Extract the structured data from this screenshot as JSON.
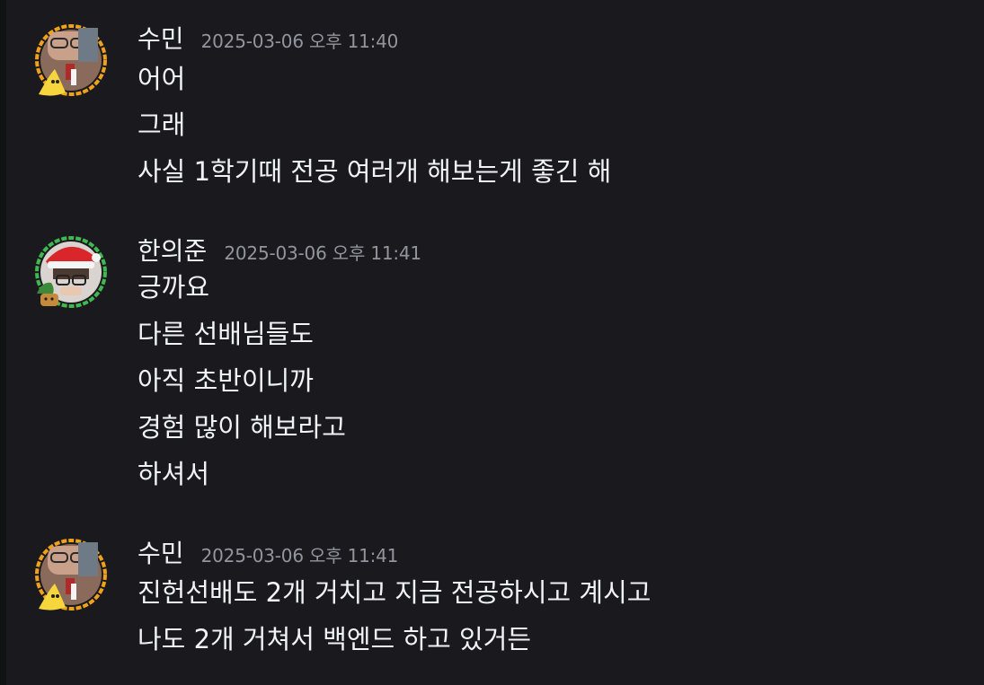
{
  "messages": [
    {
      "author": "수민",
      "timestamp": "2025-03-06 오후 11:40",
      "lines": [
        "어어",
        "그래",
        "사실 1학기때 전공 여러개 해보는게 좋긴 해"
      ],
      "avatar": "avatar-sumin",
      "ring_color": "#f0a21b"
    },
    {
      "author": "한의준",
      "timestamp": "2025-03-06 오후 11:41",
      "lines": [
        "긍까요",
        "다른 선배님들도",
        "아직 초반이니까",
        "경험 많이 해보라고",
        "하셔서"
      ],
      "avatar": "avatar-uijun",
      "ring_color": "#3fb950"
    },
    {
      "author": "수민",
      "timestamp": "2025-03-06 오후 11:41",
      "lines": [
        "진헌선배도 2개 거치고 지금 전공하시고 계시고",
        "나도 2개 거쳐서 백엔드 하고 있거든"
      ],
      "avatar": "avatar-sumin",
      "ring_color": "#f0a21b"
    }
  ]
}
